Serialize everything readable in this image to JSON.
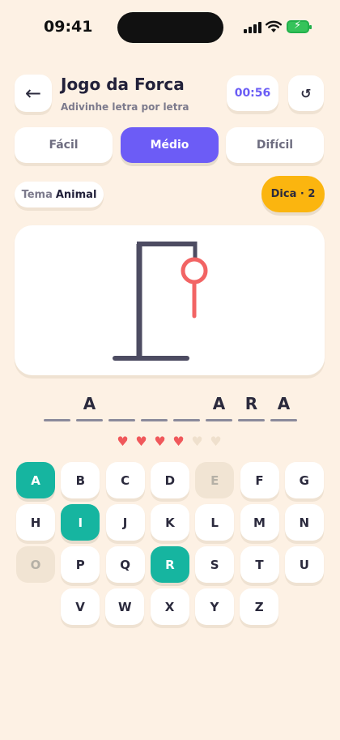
{
  "status": {
    "time": "09:41"
  },
  "header": {
    "back_icon": "arrow-left-icon",
    "title": "Jogo da Forca",
    "subtitle": "Adivinhe letra por letra",
    "timer": "00:56",
    "reset_icon": "refresh-icon"
  },
  "difficulty": {
    "options": [
      "Fácil",
      "Médio",
      "Difícil"
    ],
    "selected": "Médio"
  },
  "theme": {
    "label": "Tema",
    "value": "Animal"
  },
  "hint": {
    "label": "Dica · 2"
  },
  "word": [
    "",
    "A",
    "",
    "",
    "",
    "A",
    "R",
    "A"
  ],
  "lives": {
    "total": 6,
    "remaining": 4
  },
  "keyboard": {
    "rows": [
      [
        "A",
        "B",
        "C",
        "D",
        "E",
        "F",
        "G"
      ],
      [
        "H",
        "I",
        "J",
        "K",
        "L",
        "M",
        "N"
      ],
      [
        "O",
        "P",
        "Q",
        "R",
        "S",
        "T",
        "U"
      ],
      [
        "V",
        "W",
        "X",
        "Y",
        "Z"
      ]
    ],
    "correct": [
      "A",
      "I",
      "R"
    ],
    "wrong": [
      "E",
      "O"
    ]
  },
  "colors": {
    "background": "#fdf1e4",
    "accent": "#6c5cf6",
    "correct": "#16b5a0",
    "hint": "#fbb50f",
    "heart": "#f0585b",
    "rope": "#f26464",
    "gallows": "#4d4c62"
  }
}
